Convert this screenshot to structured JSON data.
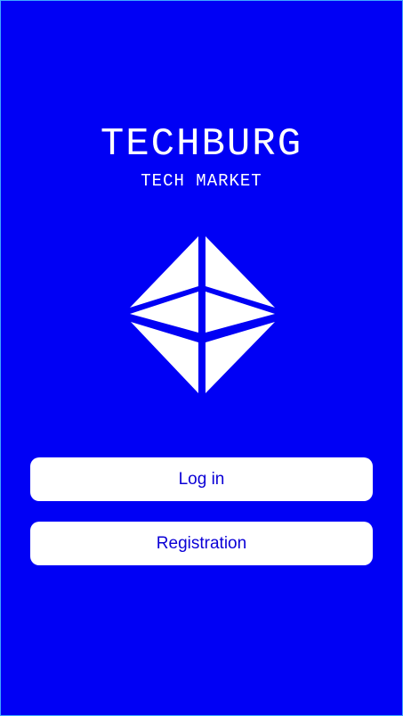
{
  "brand": {
    "title": "TECHBURG",
    "subtitle": "TECH MARKET",
    "logo_icon": "diamond-logo-icon"
  },
  "actions": {
    "login_label": "Log in",
    "registration_label": "Registration"
  },
  "colors": {
    "background": "#0000f5",
    "button_background": "#ffffff",
    "button_text": "#0b00d6",
    "brand_text": "#ffffff"
  }
}
